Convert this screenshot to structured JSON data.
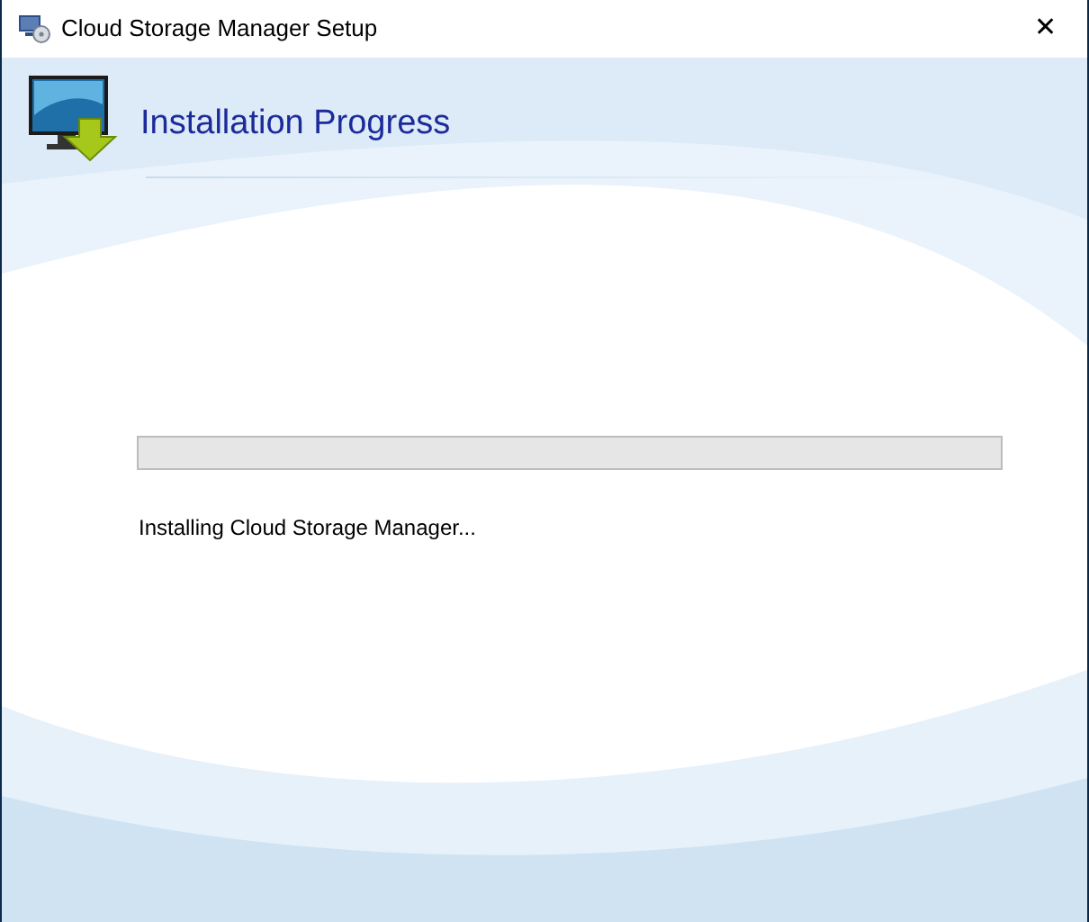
{
  "window": {
    "title": "Cloud Storage Manager Setup",
    "close": "✕"
  },
  "header": {
    "title": "Installation Progress"
  },
  "progress": {
    "level": 0
  },
  "status": "Installing Cloud Storage Manager..."
}
